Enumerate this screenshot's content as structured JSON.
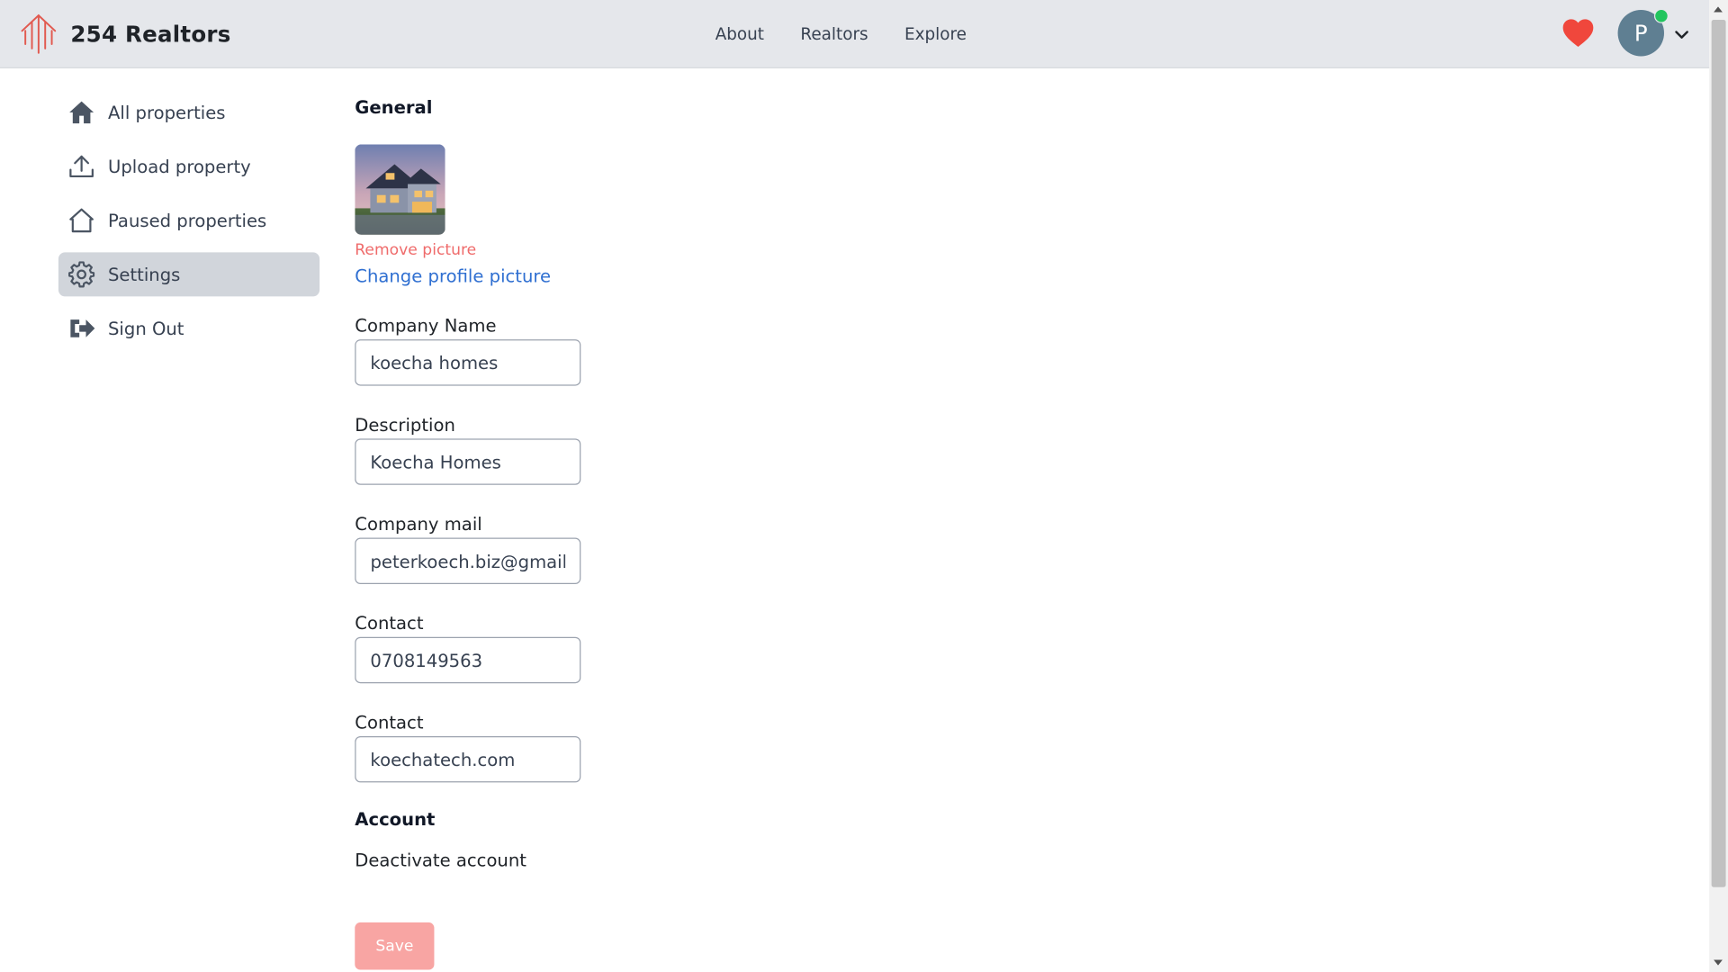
{
  "brand": {
    "name": "254 Realtors",
    "accent": "#e15a50"
  },
  "nav": {
    "items": [
      "About",
      "Realtors",
      "Explore"
    ]
  },
  "user": {
    "initial": "P",
    "status_color": "#22c55e"
  },
  "sidebar": {
    "items": [
      {
        "label": "All properties",
        "icon": "home-filled-icon"
      },
      {
        "label": "Upload property",
        "icon": "upload-icon"
      },
      {
        "label": "Paused properties",
        "icon": "home-outline-icon"
      },
      {
        "label": "Settings",
        "icon": "gear-icon",
        "active": true
      },
      {
        "label": "Sign Out",
        "icon": "sign-out-icon"
      }
    ]
  },
  "general": {
    "title": "General",
    "remove_picture": "Remove picture",
    "change_picture": "Change profile picture",
    "fields": [
      {
        "label": "Company Name",
        "value": "koecha homes"
      },
      {
        "label": "Description",
        "value": "Koecha Homes"
      },
      {
        "label": "Company mail",
        "value": "peterkoech.biz@gmail.com"
      },
      {
        "label": "Contact",
        "value": "0708149563"
      },
      {
        "label": "Contact",
        "value": "koechatech.com"
      }
    ]
  },
  "account": {
    "title": "Account",
    "deactivate": "Deactivate account"
  },
  "actions": {
    "save": "Save",
    "save_color": "#f8a5a3"
  }
}
